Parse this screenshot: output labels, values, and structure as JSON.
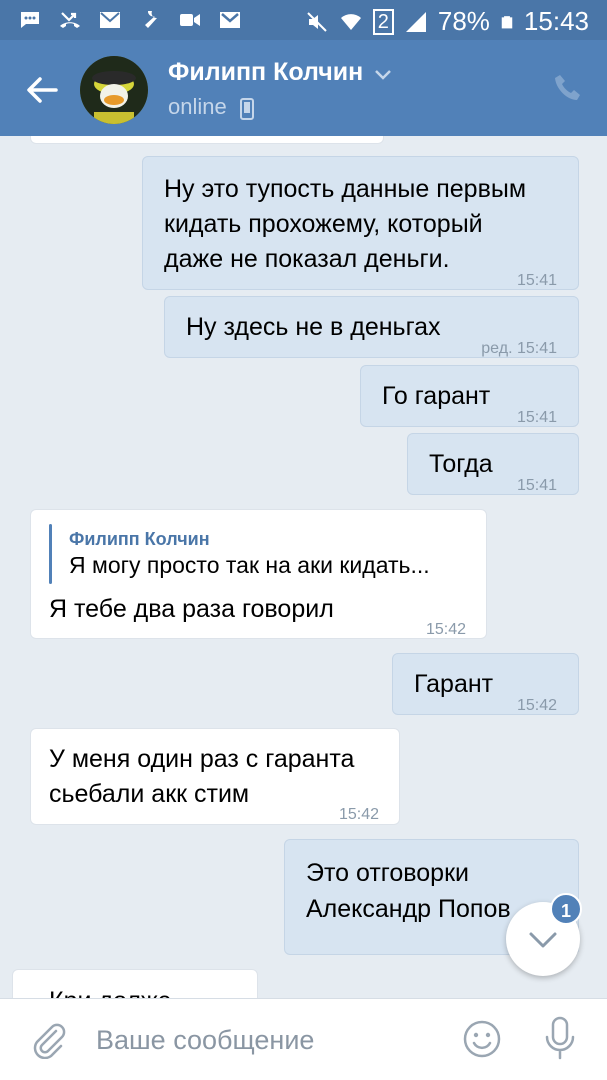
{
  "status_bar": {
    "battery": "78%",
    "time": "15:43",
    "sim": "2"
  },
  "header": {
    "name": "Филипп Колчин",
    "status": "online"
  },
  "messages": [
    {
      "dir": "out",
      "text": [
        "Ну это тупость данные первым",
        "кидать прохожему, который",
        "даже не показал деньги."
      ],
      "time": "15:41"
    },
    {
      "dir": "out",
      "text": [
        "Ну здесь не в деньгах"
      ],
      "time": "ред. 15:41"
    },
    {
      "dir": "out",
      "text": [
        "Го гарант"
      ],
      "time": "15:41"
    },
    {
      "dir": "out",
      "text": [
        "Тогда"
      ],
      "time": "15:41"
    },
    {
      "dir": "in",
      "reply": {
        "name": "Филипп Колчин",
        "text": "Я могу просто так на аки кидать..."
      },
      "text": [
        "Я тебе два раза говорил"
      ],
      "time": "15:42"
    },
    {
      "dir": "out",
      "text": [
        "Гарант"
      ],
      "time": "15:42"
    },
    {
      "dir": "in",
      "text": [
        "У меня один раз с гаранта",
        "сьебали акк стим"
      ],
      "time": "15:42"
    },
    {
      "dir": "out",
      "text": [
        "Это отговорки",
        "Александр Попов"
      ],
      "time": ""
    },
    {
      "dir": "in",
      "text": [
        "Кри долже"
      ],
      "time": ""
    }
  ],
  "scroll_down": {
    "unread_count": "1"
  },
  "composer": {
    "placeholder": "Ваше сообщение"
  },
  "colors": {
    "header": "#5181b8",
    "status_bar": "#4a76a8",
    "chat_bg": "#e6ecf2",
    "outgoing_bubble": "#d7e4f1",
    "incoming_bubble": "#ffffff"
  },
  "icons": [
    "back-arrow-icon",
    "chevron-down-icon",
    "mobile-phone-icon",
    "phone-call-icon",
    "paperclip-icon",
    "smile-icon",
    "microphone-icon",
    "arrow-down-icon"
  ]
}
